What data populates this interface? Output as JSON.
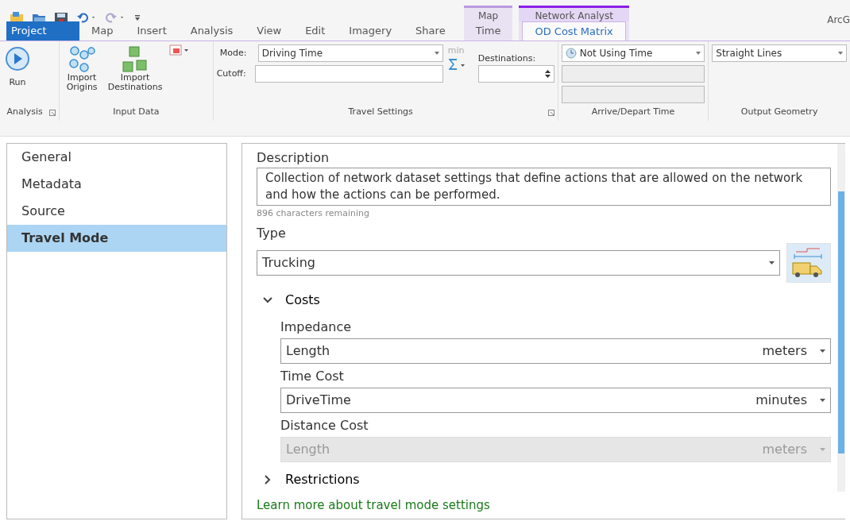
{
  "app_title": "ArcG",
  "tabs": [
    {
      "label": "Project",
      "selected": false,
      "kind": "file"
    },
    {
      "label": "Map",
      "selected": false,
      "kind": "normal"
    },
    {
      "label": "Insert",
      "selected": false,
      "kind": "normal"
    },
    {
      "label": "Analysis",
      "selected": false,
      "kind": "normal"
    },
    {
      "label": "View",
      "selected": false,
      "kind": "normal"
    },
    {
      "label": "Edit",
      "selected": false,
      "kind": "normal"
    },
    {
      "label": "Imagery",
      "selected": false,
      "kind": "normal"
    },
    {
      "label": "Share",
      "selected": false,
      "kind": "normal"
    }
  ],
  "contextual_groups": [
    {
      "label": "Map",
      "tabs": [
        {
          "label": "Time",
          "selected": false
        }
      ]
    },
    {
      "label": "Network Analyst",
      "tabs": [
        {
          "label": "OD Cost Matrix",
          "selected": true
        }
      ]
    }
  ],
  "ribbon": {
    "analysis": {
      "label": "Analysis",
      "run": "Run"
    },
    "input_data": {
      "label": "Input Data",
      "buttons": [
        "Import Origins",
        "Import Destinations"
      ]
    },
    "travel_settings": {
      "label": "Travel Settings",
      "mode_label": "Mode:",
      "mode": "Driving Time",
      "unit": "min",
      "cutoff_label": "Cutoff:",
      "destinations_label": "Destinations:"
    },
    "arrive_depart": {
      "label": "Arrive/Depart Time",
      "value": "Not Using Time"
    },
    "output_geometry": {
      "label": "Output Geometry",
      "value": "Straight Lines"
    }
  },
  "sidebar": {
    "items": [
      {
        "label": "General",
        "selected": false
      },
      {
        "label": "Metadata",
        "selected": false
      },
      {
        "label": "Source",
        "selected": false
      },
      {
        "label": "Travel Mode",
        "selected": true
      }
    ]
  },
  "details": {
    "description_label": "Description",
    "description": "Collection of network dataset settings that define actions that are allowed on the network and how the actions can be performed.",
    "remaining": "896 characters remaining",
    "type_label": "Type",
    "type": "Trucking",
    "sections": [
      {
        "label": "Costs",
        "expanded": true,
        "fields": [
          {
            "label": "Impedance",
            "value": "Length",
            "unit": "meters",
            "disabled": false
          },
          {
            "label": "Time Cost",
            "value": "DriveTime",
            "unit": "minutes",
            "disabled": false
          },
          {
            "label": "Distance Cost",
            "value": "Length",
            "unit": "meters",
            "disabled": true
          }
        ]
      },
      {
        "label": "Restrictions",
        "expanded": false
      }
    ],
    "link": "Learn more about travel mode settings"
  }
}
